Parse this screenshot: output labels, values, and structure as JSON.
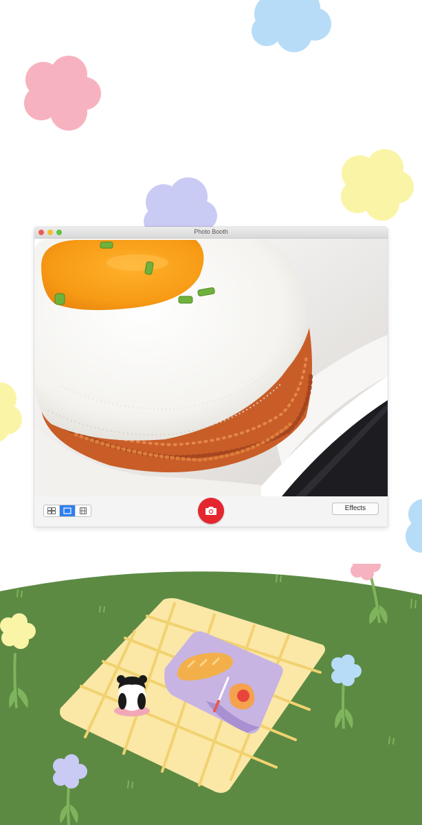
{
  "window": {
    "title": "Photo Booth",
    "traffic_lights": [
      {
        "name": "close",
        "color": "#ee5a52"
      },
      {
        "name": "minimize",
        "color": "#f5bd2e"
      },
      {
        "name": "zoom",
        "color": "#5fc53f"
      }
    ]
  },
  "toolbar": {
    "view_modes": [
      {
        "name": "four-up",
        "icon": "grid-2x2-icon",
        "active": false
      },
      {
        "name": "single",
        "icon": "single-frame-icon",
        "active": true
      },
      {
        "name": "filmstrip",
        "icon": "filmstrip-icon",
        "active": false
      }
    ],
    "shutter_icon": "camera-icon",
    "shutter_color": "#e4262f",
    "effects_label": "Effects"
  },
  "viewer": {
    "subject": "camera-preview"
  },
  "decor": {
    "cloud_colors": {
      "blue": "#b6dcf8",
      "pink": "#f6b3bf",
      "lavender": "#c9cbf4",
      "yellow": "#faf4a6"
    },
    "grass_color": "#5c8a43",
    "blanket_color": "#fbe7a6",
    "blanket_line_color": "#f1d270"
  }
}
